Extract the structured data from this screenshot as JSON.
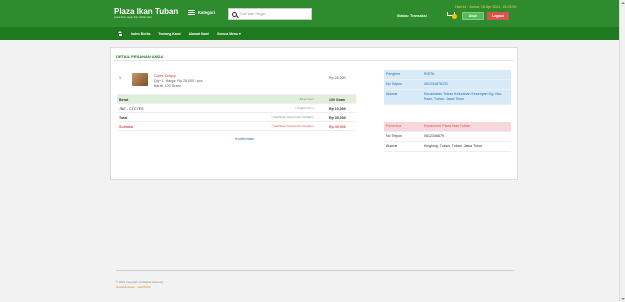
{
  "header": {
    "brand_name": "Plaza Ikan Tuban",
    "brand_tagline": "pusat ikan segar dan olahan ikan",
    "kategori_label": "Kategori",
    "search_placeholder": "Cari Ikan Segar...",
    "datetime": "Hari ini : Jumat, 16 Apr 2021, 15:23:00",
    "status_label": "Status: Transaksi",
    "akun_label": "Akun",
    "logout_label": "Logout",
    "colors": {
      "bar": "#2e8b2e",
      "nav": "#1f7a1f",
      "akun": "#5cb85c",
      "logout": "#d9534f",
      "badge": "#ffc107"
    }
  },
  "nav": {
    "items": [
      "Index Berita",
      "Tentang Kami",
      "Alamat Kami",
      "Semua Menu ▾"
    ],
    "home_icon": "home-icon"
  },
  "order": {
    "title": "DETAIL PESANAN ANDA",
    "item": {
      "no": "1",
      "name": "Cumi Crispy",
      "qty_price": "Qty: 1, Harga: Rp 25.000 / pcs",
      "berat": "Berat: 100 Gram",
      "price": "Rp 25,000"
    },
    "berat_row": {
      "label": "Berat",
      "note": "( Berat Total )",
      "value": "100 Gram"
    },
    "ongkir_row": {
      "label": "JNE - CTCYES",
      "note": "( Ongkos Kirim )",
      "value": "Rp 10,000"
    },
    "total_row": {
      "label": "Total",
      "note": "( Total Bayar Tanpa Kode Transaksi )",
      "value": "Rp 35,000"
    },
    "subtotal_row": {
      "label": "Subtotal",
      "note": "( Total Bayar Tanpa Kode Transaksi )",
      "value": "Rp 35,000"
    },
    "konfirmasi_label": "Konfirmasi"
  },
  "pengirim": {
    "head": {
      "k": "Pengirim",
      "v": "RISTA"
    },
    "telp": {
      "k": "No Telpon",
      "v": "081234876231"
    },
    "alamat": {
      "k": "Alamat",
      "v": "Kecamatan Tuban Kelurahan Kesenyan Gg. Nur-Kasir, Tuban, Jawa Timur"
    }
  },
  "penerima": {
    "head": {
      "k": "Penerima",
      "v": "Konsumen Plaza Ikan Tuban"
    },
    "telp": {
      "k": "No Telpon",
      "v": "0812346879"
    },
    "alamat": {
      "k": "Alamat",
      "v": "Kingking, Tuban, Tuban, Jawa Timur"
    }
  },
  "footer": {
    "copyright": "© 2021 Copyright. All Rights reserved.",
    "credit": "plazaikantuban - siteDTKA6"
  }
}
